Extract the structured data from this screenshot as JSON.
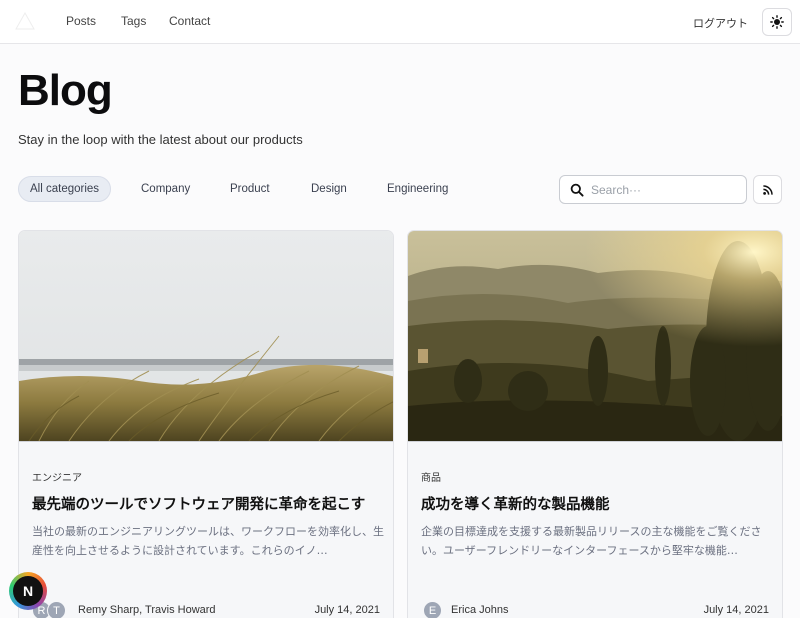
{
  "nav": {
    "links": [
      "Posts",
      "Tags",
      "Contact"
    ],
    "logout_label": "ログアウト",
    "theme_icon": "sun-icon"
  },
  "header": {
    "title": "Blog",
    "subtitle": "Stay in the loop with the latest about our products"
  },
  "filters": {
    "categories": [
      "All categories",
      "Company",
      "Product",
      "Design",
      "Engineering"
    ],
    "active": "All categories",
    "search_placeholder": "Search···",
    "search_value": "",
    "rss_icon": "rss-icon"
  },
  "posts": [
    {
      "tag": "エンジニア",
      "title": "最先端のツールでソフトウェア開発に革命を起こす",
      "excerpt": "当社の最新のエンジニアリングツールは、ワークフローを効率化し、生産性を向上させるように設計されています。これらのイノ…",
      "avatars": [
        "R",
        "T"
      ],
      "authors": "Remy Sharp, Travis Howard",
      "date": "July 14, 2021",
      "image": "grass-dunes-by-sea"
    },
    {
      "tag": "商品",
      "title": "成功を導く革新的な製品機能",
      "excerpt": "企業の目標達成を支援する最新製品リリースの主な機能をご覧ください。ユーザーフレンドリーなインターフェースから堅牢な機能…",
      "avatars": [
        "E"
      ],
      "authors": "Erica Johns",
      "date": "July 14, 2021",
      "image": "sunlit-hills-landscape"
    }
  ],
  "badge": {
    "letter": "N"
  },
  "colors": {
    "accent_chip": "#e8ecf3",
    "muted_text": "#6b7080",
    "card_bg": "#f6f7f9",
    "avatar": "#9ea6b5"
  }
}
